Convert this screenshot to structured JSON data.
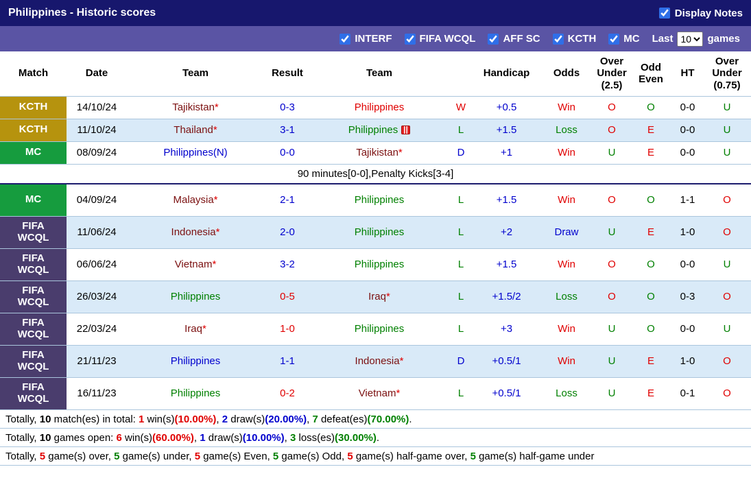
{
  "titlebar": {
    "title": "Philippines - Historic scores",
    "display_notes_label": "Display Notes",
    "display_notes_checked": true
  },
  "filterbar": {
    "filters": [
      {
        "label": "INTERF",
        "checked": true
      },
      {
        "label": "FIFA WCQL",
        "checked": true
      },
      {
        "label": "AFF SC",
        "checked": true
      },
      {
        "label": "KCTH",
        "checked": true
      },
      {
        "label": "MC",
        "checked": true
      }
    ],
    "last_label": "Last",
    "games_count": "10",
    "games_label": "games"
  },
  "table": {
    "star_symbol": "*",
    "headers": [
      "Match",
      "Date",
      "Team",
      "Result",
      "Team",
      "",
      "Handicap",
      "Odds",
      "Over\nUnder\n(2.5)",
      "Odd\nEven",
      "HT",
      "Over\nUnder\n(0.75)"
    ],
    "rows": [
      {
        "comp": "KCTH",
        "comp_key": "kcth",
        "date": "14/10/24",
        "home": {
          "name": "Tajikistan",
          "star": true,
          "color": "maroon"
        },
        "score": {
          "text": "0-3",
          "color": "blue"
        },
        "away": {
          "name": "Philippines",
          "star": false,
          "color": "red"
        },
        "wdl": {
          "text": "W",
          "color": "red"
        },
        "handicap": "+0.5",
        "odds": {
          "text": "Win",
          "color": "red"
        },
        "ou25": {
          "text": "O",
          "color": "red"
        },
        "oddeven": {
          "text": "O",
          "color": "green"
        },
        "ht": "0-0",
        "ou075": {
          "text": "U",
          "color": "green"
        },
        "shade": false,
        "compact": true
      },
      {
        "comp": "KCTH",
        "comp_key": "kcth",
        "date": "11/10/24",
        "home": {
          "name": "Thailand",
          "star": true,
          "color": "maroon"
        },
        "score": {
          "text": "3-1",
          "color": "blue"
        },
        "away": {
          "name": "Philippines",
          "star": false,
          "color": "green",
          "icon": "red-card-icon"
        },
        "wdl": {
          "text": "L",
          "color": "green"
        },
        "handicap": "+1.5",
        "odds": {
          "text": "Loss",
          "color": "green"
        },
        "ou25": {
          "text": "O",
          "color": "red"
        },
        "oddeven": {
          "text": "E",
          "color": "red"
        },
        "ht": "0-0",
        "ou075": {
          "text": "U",
          "color": "green"
        },
        "shade": true,
        "compact": true
      },
      {
        "comp": "MC",
        "comp_key": "mc",
        "date": "08/09/24",
        "home": {
          "name": "Philippines(N)",
          "star": false,
          "color": "blue"
        },
        "score": {
          "text": "0-0",
          "color": "blue"
        },
        "away": {
          "name": "Tajikistan",
          "star": true,
          "color": "maroon"
        },
        "wdl": {
          "text": "D",
          "color": "blue"
        },
        "handicap": "+1",
        "odds": {
          "text": "Win",
          "color": "red"
        },
        "ou25": {
          "text": "U",
          "color": "green"
        },
        "oddeven": {
          "text": "E",
          "color": "red"
        },
        "ht": "0-0",
        "ou075": {
          "text": "U",
          "color": "green"
        },
        "shade": false,
        "compact": true,
        "note": "90 minutes[0-0],Penalty Kicks[3-4]"
      },
      {
        "comp": "MC",
        "comp_key": "mc",
        "date": "04/09/24",
        "home": {
          "name": "Malaysia",
          "star": true,
          "color": "maroon"
        },
        "score": {
          "text": "2-1",
          "color": "blue"
        },
        "away": {
          "name": "Philippines",
          "star": false,
          "color": "green"
        },
        "wdl": {
          "text": "L",
          "color": "green"
        },
        "handicap": "+1.5",
        "odds": {
          "text": "Win",
          "color": "red"
        },
        "ou25": {
          "text": "O",
          "color": "red"
        },
        "oddeven": {
          "text": "O",
          "color": "green"
        },
        "ht": "1-1",
        "ou075": {
          "text": "O",
          "color": "red"
        },
        "shade": false
      },
      {
        "comp": "FIFA\nWCQL",
        "comp_key": "fifa",
        "date": "11/06/24",
        "home": {
          "name": "Indonesia",
          "star": true,
          "color": "maroon"
        },
        "score": {
          "text": "2-0",
          "color": "blue"
        },
        "away": {
          "name": "Philippines",
          "star": false,
          "color": "green"
        },
        "wdl": {
          "text": "L",
          "color": "green"
        },
        "handicap": "+2",
        "odds": {
          "text": "Draw",
          "color": "blue"
        },
        "ou25": {
          "text": "U",
          "color": "green"
        },
        "oddeven": {
          "text": "E",
          "color": "red"
        },
        "ht": "1-0",
        "ou075": {
          "text": "O",
          "color": "red"
        },
        "shade": true
      },
      {
        "comp": "FIFA\nWCQL",
        "comp_key": "fifa",
        "date": "06/06/24",
        "home": {
          "name": "Vietnam",
          "star": true,
          "color": "maroon"
        },
        "score": {
          "text": "3-2",
          "color": "blue"
        },
        "away": {
          "name": "Philippines",
          "star": false,
          "color": "green"
        },
        "wdl": {
          "text": "L",
          "color": "green"
        },
        "handicap": "+1.5",
        "odds": {
          "text": "Win",
          "color": "red"
        },
        "ou25": {
          "text": "O",
          "color": "red"
        },
        "oddeven": {
          "text": "O",
          "color": "green"
        },
        "ht": "0-0",
        "ou075": {
          "text": "U",
          "color": "green"
        },
        "shade": false
      },
      {
        "comp": "FIFA\nWCQL",
        "comp_key": "fifa",
        "date": "26/03/24",
        "home": {
          "name": "Philippines",
          "star": false,
          "color": "green"
        },
        "score": {
          "text": "0-5",
          "color": "red"
        },
        "away": {
          "name": "Iraq",
          "star": true,
          "color": "maroon"
        },
        "wdl": {
          "text": "L",
          "color": "green"
        },
        "handicap": "+1.5/2",
        "odds": {
          "text": "Loss",
          "color": "green"
        },
        "ou25": {
          "text": "O",
          "color": "red"
        },
        "oddeven": {
          "text": "O",
          "color": "green"
        },
        "ht": "0-3",
        "ou075": {
          "text": "O",
          "color": "red"
        },
        "shade": true
      },
      {
        "comp": "FIFA\nWCQL",
        "comp_key": "fifa",
        "date": "22/03/24",
        "home": {
          "name": "Iraq",
          "star": true,
          "color": "maroon"
        },
        "score": {
          "text": "1-0",
          "color": "red"
        },
        "away": {
          "name": "Philippines",
          "star": false,
          "color": "green"
        },
        "wdl": {
          "text": "L",
          "color": "green"
        },
        "handicap": "+3",
        "odds": {
          "text": "Win",
          "color": "red"
        },
        "ou25": {
          "text": "U",
          "color": "green"
        },
        "oddeven": {
          "text": "O",
          "color": "green"
        },
        "ht": "0-0",
        "ou075": {
          "text": "U",
          "color": "green"
        },
        "shade": false
      },
      {
        "comp": "FIFA\nWCQL",
        "comp_key": "fifa",
        "date": "21/11/23",
        "home": {
          "name": "Philippines",
          "star": false,
          "color": "blue"
        },
        "score": {
          "text": "1-1",
          "color": "blue"
        },
        "away": {
          "name": "Indonesia",
          "star": true,
          "color": "maroon"
        },
        "wdl": {
          "text": "D",
          "color": "blue"
        },
        "handicap": "+0.5/1",
        "odds": {
          "text": "Win",
          "color": "red"
        },
        "ou25": {
          "text": "U",
          "color": "green"
        },
        "oddeven": {
          "text": "E",
          "color": "red"
        },
        "ht": "1-0",
        "ou075": {
          "text": "O",
          "color": "red"
        },
        "shade": true
      },
      {
        "comp": "FIFA\nWCQL",
        "comp_key": "fifa",
        "date": "16/11/23",
        "home": {
          "name": "Philippines",
          "star": false,
          "color": "green"
        },
        "score": {
          "text": "0-2",
          "color": "red"
        },
        "away": {
          "name": "Vietnam",
          "star": true,
          "color": "maroon"
        },
        "wdl": {
          "text": "L",
          "color": "green"
        },
        "handicap": "+0.5/1",
        "odds": {
          "text": "Loss",
          "color": "green"
        },
        "ou25": {
          "text": "U",
          "color": "green"
        },
        "oddeven": {
          "text": "E",
          "color": "red"
        },
        "ht": "0-1",
        "ou075": {
          "text": "O",
          "color": "red"
        },
        "shade": false
      }
    ]
  },
  "summary": {
    "lines": [
      {
        "segments": [
          {
            "text": "Totally, ",
            "color": "black",
            "bold": false
          },
          {
            "text": "10",
            "color": "black",
            "bold": true
          },
          {
            "text": " match(es) in total: ",
            "color": "black",
            "bold": false
          },
          {
            "text": "1",
            "color": "red",
            "bold": true
          },
          {
            "text": " win(s)",
            "color": "black",
            "bold": false
          },
          {
            "text": "(10.00%)",
            "color": "red",
            "bold": true
          },
          {
            "text": ", ",
            "color": "black",
            "bold": false
          },
          {
            "text": "2",
            "color": "blue",
            "bold": true
          },
          {
            "text": " draw(s)",
            "color": "black",
            "bold": false
          },
          {
            "text": "(20.00%)",
            "color": "blue",
            "bold": true
          },
          {
            "text": ", ",
            "color": "black",
            "bold": false
          },
          {
            "text": "7",
            "color": "green",
            "bold": true
          },
          {
            "text": " defeat(es)",
            "color": "black",
            "bold": false
          },
          {
            "text": "(70.00%)",
            "color": "green",
            "bold": true
          },
          {
            "text": ".",
            "color": "black",
            "bold": false
          }
        ]
      },
      {
        "segments": [
          {
            "text": "Totally, ",
            "color": "black",
            "bold": false
          },
          {
            "text": "10",
            "color": "black",
            "bold": true
          },
          {
            "text": " games open: ",
            "color": "black",
            "bold": false
          },
          {
            "text": "6",
            "color": "red",
            "bold": true
          },
          {
            "text": " win(s)",
            "color": "black",
            "bold": false
          },
          {
            "text": "(60.00%)",
            "color": "red",
            "bold": true
          },
          {
            "text": ", ",
            "color": "black",
            "bold": false
          },
          {
            "text": "1",
            "color": "blue",
            "bold": true
          },
          {
            "text": " draw(s)",
            "color": "black",
            "bold": false
          },
          {
            "text": "(10.00%)",
            "color": "blue",
            "bold": true
          },
          {
            "text": ", ",
            "color": "black",
            "bold": false
          },
          {
            "text": "3",
            "color": "green",
            "bold": true
          },
          {
            "text": " loss(es)",
            "color": "black",
            "bold": false
          },
          {
            "text": "(30.00%)",
            "color": "green",
            "bold": true
          },
          {
            "text": ".",
            "color": "black",
            "bold": false
          }
        ]
      },
      {
        "segments": [
          {
            "text": "Totally, ",
            "color": "black",
            "bold": false
          },
          {
            "text": "5",
            "color": "red",
            "bold": true
          },
          {
            "text": " game(s) over, ",
            "color": "black",
            "bold": false
          },
          {
            "text": "5",
            "color": "green",
            "bold": true
          },
          {
            "text": " game(s) under, ",
            "color": "black",
            "bold": false
          },
          {
            "text": "5",
            "color": "red",
            "bold": true
          },
          {
            "text": " game(s) Even, ",
            "color": "black",
            "bold": false
          },
          {
            "text": "5",
            "color": "green",
            "bold": true
          },
          {
            "text": " game(s) Odd, ",
            "color": "black",
            "bold": false
          },
          {
            "text": "5",
            "color": "red",
            "bold": true
          },
          {
            "text": " game(s) half-game over, ",
            "color": "black",
            "bold": false
          },
          {
            "text": "5",
            "color": "green",
            "bold": true
          },
          {
            "text": " game(s) half-game under",
            "color": "black",
            "bold": false
          }
        ]
      }
    ]
  },
  "colors": {
    "red": "#e00000",
    "green": "#008000",
    "blue": "#0000cd",
    "maroon": "#7b1010",
    "black": "#000000",
    "titlebar_bg": "#17176d",
    "filterbar_bg": "#5a54a4",
    "checkbox_accent": "#2f6fe8",
    "row_shade": "#d9eaf8",
    "grid_line": "#aac5dd",
    "separator": "#1c1c6e",
    "badge_kcth": "#b6930e",
    "badge_mc": "#169c3e",
    "badge_fifa": "#4a3d6d"
  }
}
